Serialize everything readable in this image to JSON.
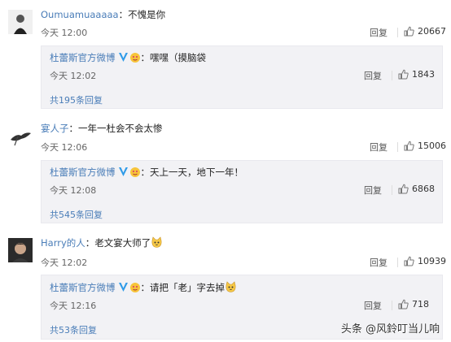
{
  "comments": [
    {
      "user": "Oumuamuaaaaa",
      "text": "：不愧是你",
      "time": "今天 12:00",
      "reply_label": "回复",
      "likes": "20667",
      "reply": {
        "user": "杜蕾斯官方微博",
        "text": "：嘿嘿（摸脑袋",
        "time": "今天 12:02",
        "reply_label": "回复",
        "likes": "1843"
      },
      "more_replies": "共195条回复"
    },
    {
      "user": "宴人子",
      "text": "：一年一杜会不会太惨",
      "time": "今天 12:06",
      "reply_label": "回复",
      "likes": "15006",
      "reply": {
        "user": "杜蕾斯官方微博",
        "text": "：天上一天，地下一年！",
        "time": "今天 12:08",
        "reply_label": "回复",
        "likes": "6868"
      },
      "more_replies": "共545条回复"
    },
    {
      "user": "Harry的人",
      "text": "：老文宴大师了",
      "time": "今天 12:02",
      "reply_label": "回复",
      "likes": "10939",
      "reply": {
        "user": "杜蕾斯官方微博",
        "text": "：请把「老」字去掉",
        "time": "今天 12:16",
        "reply_label": "回复",
        "likes": "718"
      },
      "more_replies": "共53条回复"
    }
  ],
  "watermark": "头条 @风鈴叮当儿响",
  "colors": {
    "link": "#4a7db8",
    "reply_bg": "#f2f2f5",
    "verified": "#2f9be8"
  }
}
